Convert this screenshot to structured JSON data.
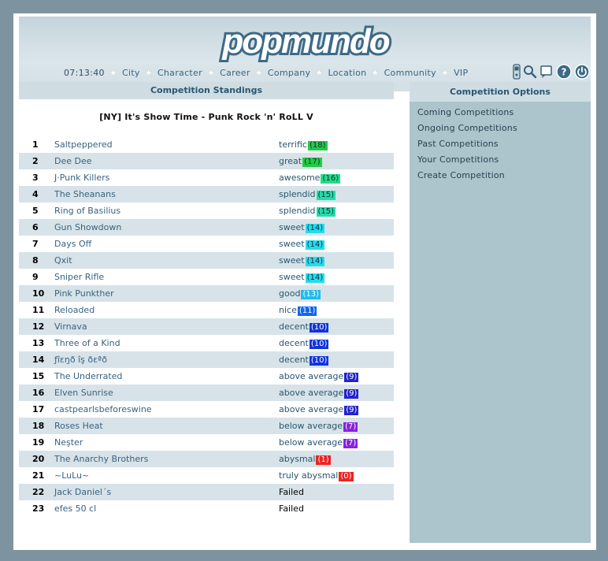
{
  "logo": {
    "text": "popmundo"
  },
  "nav": {
    "clock": "07:13:40",
    "links": [
      "City",
      "Character",
      "Career",
      "Company",
      "Location",
      "Community",
      "VIP"
    ]
  },
  "tool_icons": [
    "phone-icon",
    "search-icon",
    "chat-icon",
    "help-icon",
    "power-icon"
  ],
  "colors": {
    "page_bg": "#7e93a0",
    "header_bg": "#c4d4dc",
    "panel_head_bg": "#cfdde3",
    "right_panel_bg": "#acc4cc",
    "row_alt_bg": "#d7e3e8",
    "link": "#3a6280"
  },
  "standings": {
    "heading": "Competition Standings",
    "title": "[NY] It's Show Time - Punk Rock 'n' RoLL V",
    "rows": [
      {
        "rank": "1",
        "band": "Saltpeppered",
        "rating": "terrific",
        "score": "(18)",
        "color": "#22cc44"
      },
      {
        "rank": "2",
        "band": "Dee Dee",
        "rating": "great",
        "score": "(17)",
        "color": "#22cc44"
      },
      {
        "rank": "3",
        "band": "J·Punk Killers",
        "rating": "awesome",
        "score": "(16)",
        "color": "#22dd88"
      },
      {
        "rank": "4",
        "band": "The Sheanans",
        "rating": "splendid",
        "score": "(15)",
        "color": "#22ddaa"
      },
      {
        "rank": "5",
        "band": "Ring of Basilius",
        "rating": "splendid",
        "score": "(15)",
        "color": "#22ddaa"
      },
      {
        "rank": "6",
        "band": "Gun Showdown",
        "rating": "sweet",
        "score": "(14)",
        "color": "#22ddee"
      },
      {
        "rank": "7",
        "band": "Days Off",
        "rating": "sweet",
        "score": "(14)",
        "color": "#22ddee"
      },
      {
        "rank": "8",
        "band": "Qxit",
        "rating": "sweet",
        "score": "(14)",
        "color": "#22ddee"
      },
      {
        "rank": "9",
        "band": "Sniper Rifle",
        "rating": "sweet",
        "score": "(14)",
        "color": "#22ddee"
      },
      {
        "rank": "10",
        "band": "Pink Punkther",
        "rating": "good",
        "score": "(13)",
        "color": "#22bbee"
      },
      {
        "rank": "11",
        "band": "Reloaded",
        "rating": "nice",
        "score": "(11)",
        "color": "#1166ee"
      },
      {
        "rank": "12",
        "band": "Virnava",
        "rating": "decent",
        "score": "(10)",
        "color": "#1133dd"
      },
      {
        "rank": "13",
        "band": "Three of a Kind",
        "rating": "decent",
        "score": "(10)",
        "color": "#1133dd"
      },
      {
        "rank": "14",
        "band": "ƒîɛŋð îş ðɛªð",
        "rating": "decent",
        "score": "(10)",
        "color": "#1133dd"
      },
      {
        "rank": "15",
        "band": "The Underrated",
        "rating": "above average",
        "score": "(9)",
        "color": "#2222cc"
      },
      {
        "rank": "16",
        "band": "Elven Sunrise",
        "rating": "above average",
        "score": "(9)",
        "color": "#2222cc"
      },
      {
        "rank": "17",
        "band": "castpearlsbeforeswine",
        "rating": "above average",
        "score": "(9)",
        "color": "#2222cc"
      },
      {
        "rank": "18",
        "band": "Roses Heat",
        "rating": "below average",
        "score": "(7)",
        "color": "#8822dd"
      },
      {
        "rank": "19",
        "band": "Neşter",
        "rating": "below average",
        "score": "(7)",
        "color": "#8822dd"
      },
      {
        "rank": "20",
        "band": "The Anarchy Brothers",
        "rating": "abysmal",
        "score": "(1)",
        "color": "#ee2222"
      },
      {
        "rank": "21",
        "band": "~LuLu~",
        "rating": "truly abysmal",
        "score": "(0)",
        "color": "#ee2222"
      },
      {
        "rank": "22",
        "band": "Jack Daniel´s",
        "rating": "Failed",
        "score": "",
        "color": ""
      },
      {
        "rank": "23",
        "band": "efes 50 cl",
        "rating": "Failed",
        "score": "",
        "color": ""
      }
    ]
  },
  "options": {
    "heading": "Competition Options",
    "items": [
      "Coming Competitions",
      "Ongoing Competitions",
      "Past Competitions",
      "Your Competitions",
      "Create Competition"
    ]
  }
}
